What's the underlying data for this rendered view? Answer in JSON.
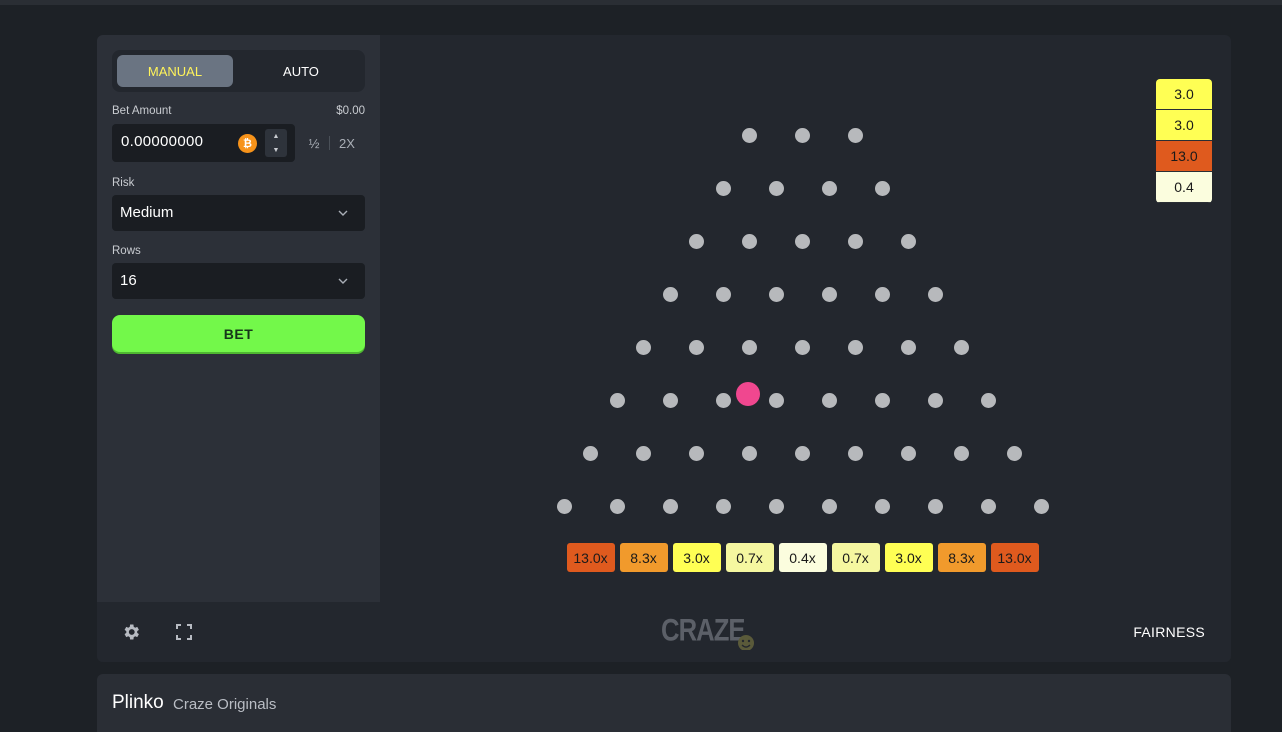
{
  "mode_tabs": {
    "manual": "MANUAL",
    "auto": "AUTO",
    "active": "manual"
  },
  "bet": {
    "label": "Bet Amount",
    "usd_value": "$0.00",
    "amount": "0.00000000",
    "currency_icon": "bitcoin-icon",
    "half_label": "½",
    "double_label": "2X"
  },
  "risk": {
    "label": "Risk",
    "value": "Medium"
  },
  "rows": {
    "label": "Rows",
    "value": "16"
  },
  "bet_button": {
    "label": "BET"
  },
  "board": {
    "peg_rows": [
      3,
      4,
      5,
      6,
      7,
      8,
      9,
      10
    ],
    "multipliers": [
      "13.0x",
      "8.3x",
      "3.0x",
      "0.7x",
      "0.4x",
      "0.7x",
      "3.0x",
      "8.3x",
      "13.0x"
    ],
    "multiplier_colors": [
      "#df5a1e",
      "#f19a2c",
      "#ffff54",
      "#f5f7a0",
      "#fbfdde",
      "#f5f7a0",
      "#ffff54",
      "#f19a2c",
      "#df5a1e"
    ],
    "ball_color": "#f0478f"
  },
  "history": [
    {
      "value": "3.0",
      "color": "#ffff54"
    },
    {
      "value": "3.0",
      "color": "#ffff54"
    },
    {
      "value": "13.0",
      "color": "#df5a1e"
    },
    {
      "value": "0.4",
      "color": "#fbfdde"
    }
  ],
  "footer": {
    "settings_icon": "gear-icon",
    "fullscreen_icon": "expand-icon",
    "logo_text": "CRAZE",
    "fairness_label": "FAIRNESS"
  },
  "game_info": {
    "title": "Plinko",
    "provider": "Craze Originals"
  },
  "colors": {
    "accent_green": "#73f84a",
    "tab_active_text": "#fff35a"
  }
}
